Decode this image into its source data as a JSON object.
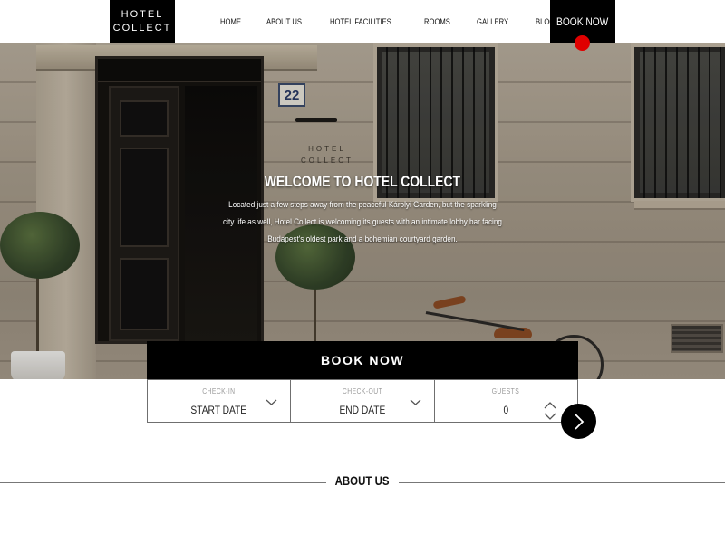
{
  "header": {
    "logo_line1": "HOTEL",
    "logo_line2": "COLLECT",
    "nav": [
      "HOME",
      "ABOUT US",
      "HOTEL FACILITIES",
      "ROOMS",
      "GALLERY",
      "BLOG"
    ],
    "book_now": "BOOK NOW"
  },
  "hero": {
    "house_number": "22",
    "plaque_line1": "HOTEL",
    "plaque_line2": "COLLECT",
    "title": "WELCOME TO HOTEL COLLECT",
    "text": "Located just a few steps away from the peaceful Károlyi Garden, but the sparkling city life as well, Hotel Collect is welcoming its guests with an intimate lobby bar facing Budapest's oldest park and a bohemian courtyard garden."
  },
  "booking": {
    "title": "BOOK NOW",
    "checkin_label": "CHECK-IN",
    "checkin_value": "START DATE",
    "checkout_label": "CHECK-OUT",
    "checkout_value": "END DATE",
    "guests_label": "GUESTS",
    "guests_value": "0"
  },
  "about": {
    "title": "ABOUT US"
  },
  "colors": {
    "accent": "#e00000",
    "dark": "#000000",
    "background": "#ffffff"
  }
}
